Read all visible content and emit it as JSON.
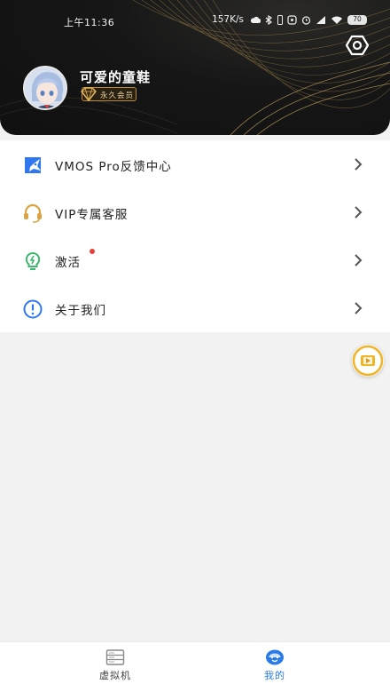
{
  "status_bar": {
    "time": "上午11:36",
    "net_speed": "157K/s",
    "battery": "70"
  },
  "profile": {
    "username": "可爱的童鞋",
    "badge": "永久会员"
  },
  "menu": {
    "items": [
      {
        "label": "VMOS Pro反馈中心",
        "icon": "feedback-icon"
      },
      {
        "label": "VIP专属客服",
        "icon": "headset-icon"
      },
      {
        "label": "激活",
        "icon": "bulb-icon",
        "badge_dot": true
      },
      {
        "label": "关于我们",
        "icon": "info-icon"
      }
    ]
  },
  "bottom_nav": {
    "tabs": [
      {
        "label": "虚拟机",
        "icon": "server-icon",
        "active": false
      },
      {
        "label": "我的",
        "icon": "profile-face-icon",
        "active": true
      }
    ]
  },
  "colors": {
    "accent": "#2a7be8",
    "gold": "#d9a441",
    "header_bg": "#141414"
  }
}
